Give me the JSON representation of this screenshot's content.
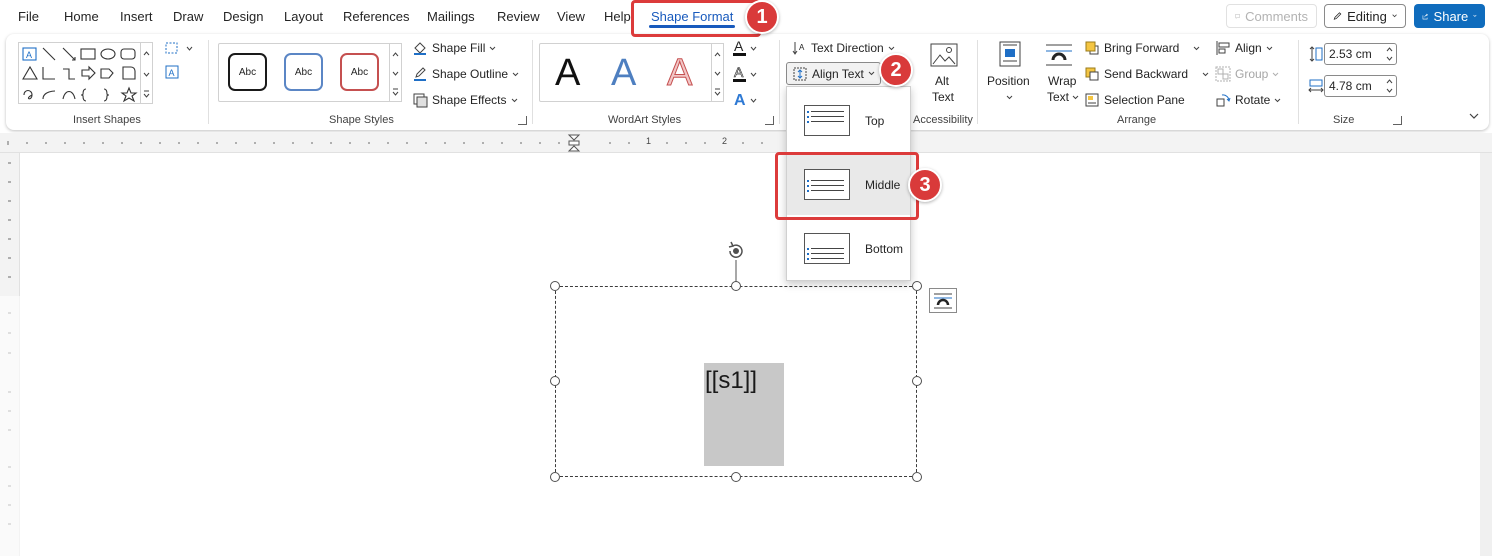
{
  "tabs": [
    {
      "label": "File"
    },
    {
      "label": "Home"
    },
    {
      "label": "Insert"
    },
    {
      "label": "Draw"
    },
    {
      "label": "Design"
    },
    {
      "label": "Layout"
    },
    {
      "label": "References"
    },
    {
      "label": "Mailings"
    },
    {
      "label": "Review"
    },
    {
      "label": "View"
    },
    {
      "label": "Help"
    },
    {
      "label": "Shape Format"
    }
  ],
  "topbar": {
    "comments_label": "Comments",
    "editing_label": "Editing",
    "share_label": "Share"
  },
  "ribbon": {
    "insert_shapes": {
      "label": "Insert Shapes"
    },
    "shape_styles": {
      "label": "Shape Styles",
      "swatches": [
        "Abc",
        "Abc",
        "Abc"
      ],
      "shape_fill": "Shape Fill",
      "shape_outline": "Shape Outline",
      "shape_effects": "Shape Effects"
    },
    "wordart_styles": {
      "label": "WordArt Styles",
      "letter": "A"
    },
    "text": {
      "text_direction": "Text Direction",
      "align_text": "Align Text"
    },
    "accessibility": {
      "label": "Accessibility",
      "alt_text_line1": "Alt",
      "alt_text_line2": "Text"
    },
    "arrange": {
      "label": "Arrange",
      "position": "Position",
      "wrap_text_line1": "Wrap",
      "wrap_text_line2": "Text",
      "bring_forward": "Bring Forward",
      "send_backward": "Send Backward",
      "selection_pane": "Selection Pane",
      "align": "Align",
      "group": "Group",
      "rotate": "Rotate"
    },
    "size": {
      "label": "Size",
      "height": "2.53 cm",
      "width": "4.78 cm"
    }
  },
  "ruler": {
    "marks": [
      "1",
      "2"
    ]
  },
  "dropdown": {
    "items": [
      {
        "label": "Top"
      },
      {
        "label": "Middle"
      },
      {
        "label": "Bottom"
      }
    ]
  },
  "document": {
    "placeholder_text": "[[s1]]"
  },
  "callouts": [
    "1",
    "2",
    "3"
  ],
  "colors": {
    "accent": "#185abd",
    "share_bg": "#0f6cbd",
    "callout": "#d93a3a",
    "placeholder_bg": "#c8c8c8"
  }
}
